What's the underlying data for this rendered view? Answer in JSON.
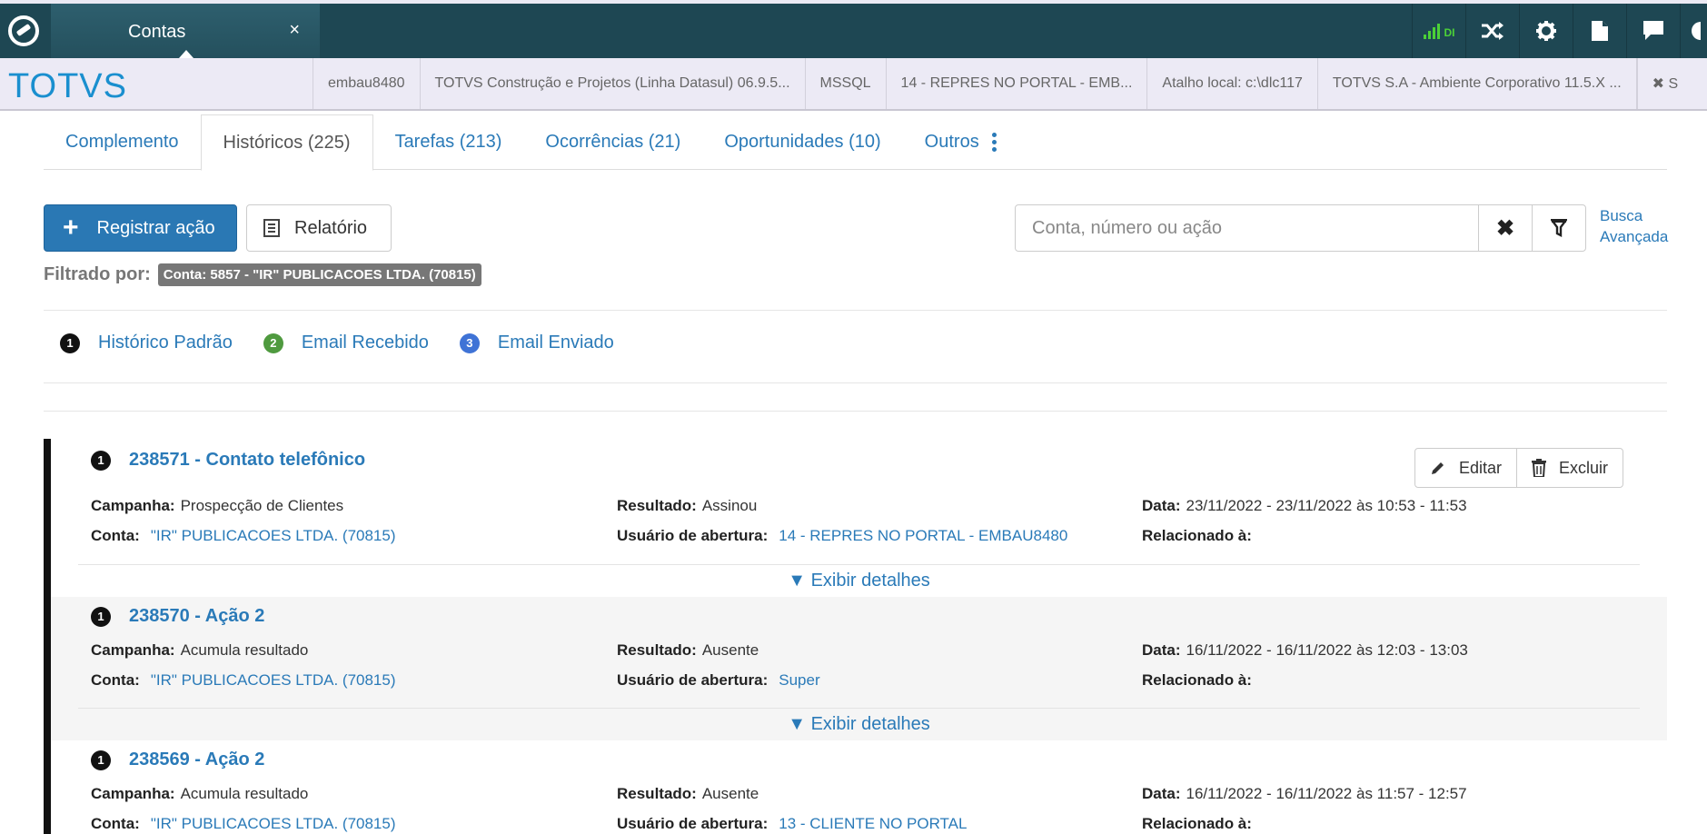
{
  "topbar": {
    "tab_label": "Contas",
    "tab_close": "×",
    "signal_label": "DI"
  },
  "infobar": {
    "brand": "TOTVS",
    "items": [
      "embau8480",
      "TOTVS Construção e Projetos (Linha Datasul) 06.9.5...",
      "MSSQL",
      "14 - REPRES NO PORTAL - EMB...",
      "Atalho local: c:\\dlc117",
      "TOTVS S.A - Ambiente Corporativo 11.5.X ...",
      "✖ S"
    ]
  },
  "tabs": [
    {
      "label": "Complemento"
    },
    {
      "label": "Históricos (225)"
    },
    {
      "label": "Tarefas (213)"
    },
    {
      "label": "Ocorrências (21)"
    },
    {
      "label": "Oportunidades (10)"
    },
    {
      "label": "Outros"
    }
  ],
  "toolbar": {
    "register_label": "Registrar ação",
    "report_label": "Relatório",
    "search_placeholder": "Conta, número ou ação",
    "advanced_search_line1": "Busca",
    "advanced_search_line2": "Avançada"
  },
  "filter": {
    "label": "Filtrado por:",
    "chip": "Conta: 5857 - \"IR\" PUBLICACOES LTDA. (70815)"
  },
  "legend": [
    {
      "num": "1",
      "label": "Histórico Padrão"
    },
    {
      "num": "2",
      "label": "Email Recebido"
    },
    {
      "num": "3",
      "label": "Email Enviado"
    }
  ],
  "labels": {
    "campanha": "Campanha:",
    "conta": "Conta:",
    "resultado": "Resultado:",
    "usuario": "Usuário de abertura:",
    "data": "Data:",
    "relacionado": "Relacionado à:",
    "details": "▼ Exibir detalhes",
    "edit": "Editar",
    "delete": "Excluir"
  },
  "records": [
    {
      "num": "1",
      "title": "238571 - Contato telefônico",
      "campanha": "Prospecção de Clientes",
      "conta": "\"IR\" PUBLICACOES LTDA. (70815)",
      "resultado": "Assinou",
      "usuario": "14 - REPRES NO PORTAL - EMBAU8480",
      "data": "23/11/2022 - 23/11/2022 às 10:53 - 11:53"
    },
    {
      "num": "1",
      "title": "238570 - Ação 2",
      "campanha": "Acumula resultado",
      "conta": "\"IR\" PUBLICACOES LTDA. (70815)",
      "resultado": "Ausente",
      "usuario": "Super",
      "data": "16/11/2022 - 16/11/2022 às 12:03 - 13:03"
    },
    {
      "num": "1",
      "title": "238569 - Ação 2",
      "campanha": "Acumula resultado",
      "conta": "\"IR\" PUBLICACOES LTDA. (70815)",
      "resultado": "Ausente",
      "usuario": "13 - CLIENTE NO PORTAL",
      "data": "16/11/2022 - 16/11/2022 às 11:57 - 12:57"
    }
  ],
  "colors": {
    "topbar": "#1e4753",
    "link": "#2a7ab8",
    "primary_button": "#2a78b4",
    "brand": "#1a8fcf"
  },
  "icons": [
    "totvs-logo-icon",
    "signal-icon",
    "shuffle-icon",
    "gear-icon",
    "document-icon",
    "chat-icon",
    "plus-icon",
    "report-icon",
    "clear-icon",
    "filter-icon",
    "kebab-icon",
    "pencil-icon",
    "trash-icon"
  ]
}
